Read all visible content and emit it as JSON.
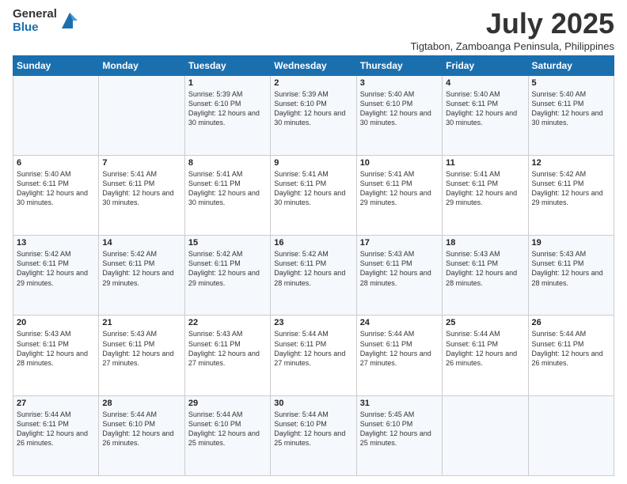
{
  "logo": {
    "general": "General",
    "blue": "Blue"
  },
  "title": "July 2025",
  "subtitle": "Tigtabon, Zamboanga Peninsula, Philippines",
  "weekdays": [
    "Sunday",
    "Monday",
    "Tuesday",
    "Wednesday",
    "Thursday",
    "Friday",
    "Saturday"
  ],
  "weeks": [
    [
      {
        "day": "",
        "info": ""
      },
      {
        "day": "",
        "info": ""
      },
      {
        "day": "1",
        "info": "Sunrise: 5:39 AM\nSunset: 6:10 PM\nDaylight: 12 hours and 30 minutes."
      },
      {
        "day": "2",
        "info": "Sunrise: 5:39 AM\nSunset: 6:10 PM\nDaylight: 12 hours and 30 minutes."
      },
      {
        "day": "3",
        "info": "Sunrise: 5:40 AM\nSunset: 6:10 PM\nDaylight: 12 hours and 30 minutes."
      },
      {
        "day": "4",
        "info": "Sunrise: 5:40 AM\nSunset: 6:11 PM\nDaylight: 12 hours and 30 minutes."
      },
      {
        "day": "5",
        "info": "Sunrise: 5:40 AM\nSunset: 6:11 PM\nDaylight: 12 hours and 30 minutes."
      }
    ],
    [
      {
        "day": "6",
        "info": "Sunrise: 5:40 AM\nSunset: 6:11 PM\nDaylight: 12 hours and 30 minutes."
      },
      {
        "day": "7",
        "info": "Sunrise: 5:41 AM\nSunset: 6:11 PM\nDaylight: 12 hours and 30 minutes."
      },
      {
        "day": "8",
        "info": "Sunrise: 5:41 AM\nSunset: 6:11 PM\nDaylight: 12 hours and 30 minutes."
      },
      {
        "day": "9",
        "info": "Sunrise: 5:41 AM\nSunset: 6:11 PM\nDaylight: 12 hours and 30 minutes."
      },
      {
        "day": "10",
        "info": "Sunrise: 5:41 AM\nSunset: 6:11 PM\nDaylight: 12 hours and 29 minutes."
      },
      {
        "day": "11",
        "info": "Sunrise: 5:41 AM\nSunset: 6:11 PM\nDaylight: 12 hours and 29 minutes."
      },
      {
        "day": "12",
        "info": "Sunrise: 5:42 AM\nSunset: 6:11 PM\nDaylight: 12 hours and 29 minutes."
      }
    ],
    [
      {
        "day": "13",
        "info": "Sunrise: 5:42 AM\nSunset: 6:11 PM\nDaylight: 12 hours and 29 minutes."
      },
      {
        "day": "14",
        "info": "Sunrise: 5:42 AM\nSunset: 6:11 PM\nDaylight: 12 hours and 29 minutes."
      },
      {
        "day": "15",
        "info": "Sunrise: 5:42 AM\nSunset: 6:11 PM\nDaylight: 12 hours and 29 minutes."
      },
      {
        "day": "16",
        "info": "Sunrise: 5:42 AM\nSunset: 6:11 PM\nDaylight: 12 hours and 28 minutes."
      },
      {
        "day": "17",
        "info": "Sunrise: 5:43 AM\nSunset: 6:11 PM\nDaylight: 12 hours and 28 minutes."
      },
      {
        "day": "18",
        "info": "Sunrise: 5:43 AM\nSunset: 6:11 PM\nDaylight: 12 hours and 28 minutes."
      },
      {
        "day": "19",
        "info": "Sunrise: 5:43 AM\nSunset: 6:11 PM\nDaylight: 12 hours and 28 minutes."
      }
    ],
    [
      {
        "day": "20",
        "info": "Sunrise: 5:43 AM\nSunset: 6:11 PM\nDaylight: 12 hours and 28 minutes."
      },
      {
        "day": "21",
        "info": "Sunrise: 5:43 AM\nSunset: 6:11 PM\nDaylight: 12 hours and 27 minutes."
      },
      {
        "day": "22",
        "info": "Sunrise: 5:43 AM\nSunset: 6:11 PM\nDaylight: 12 hours and 27 minutes."
      },
      {
        "day": "23",
        "info": "Sunrise: 5:44 AM\nSunset: 6:11 PM\nDaylight: 12 hours and 27 minutes."
      },
      {
        "day": "24",
        "info": "Sunrise: 5:44 AM\nSunset: 6:11 PM\nDaylight: 12 hours and 27 minutes."
      },
      {
        "day": "25",
        "info": "Sunrise: 5:44 AM\nSunset: 6:11 PM\nDaylight: 12 hours and 26 minutes."
      },
      {
        "day": "26",
        "info": "Sunrise: 5:44 AM\nSunset: 6:11 PM\nDaylight: 12 hours and 26 minutes."
      }
    ],
    [
      {
        "day": "27",
        "info": "Sunrise: 5:44 AM\nSunset: 6:11 PM\nDaylight: 12 hours and 26 minutes."
      },
      {
        "day": "28",
        "info": "Sunrise: 5:44 AM\nSunset: 6:10 PM\nDaylight: 12 hours and 26 minutes."
      },
      {
        "day": "29",
        "info": "Sunrise: 5:44 AM\nSunset: 6:10 PM\nDaylight: 12 hours and 25 minutes."
      },
      {
        "day": "30",
        "info": "Sunrise: 5:44 AM\nSunset: 6:10 PM\nDaylight: 12 hours and 25 minutes."
      },
      {
        "day": "31",
        "info": "Sunrise: 5:45 AM\nSunset: 6:10 PM\nDaylight: 12 hours and 25 minutes."
      },
      {
        "day": "",
        "info": ""
      },
      {
        "day": "",
        "info": ""
      }
    ]
  ]
}
